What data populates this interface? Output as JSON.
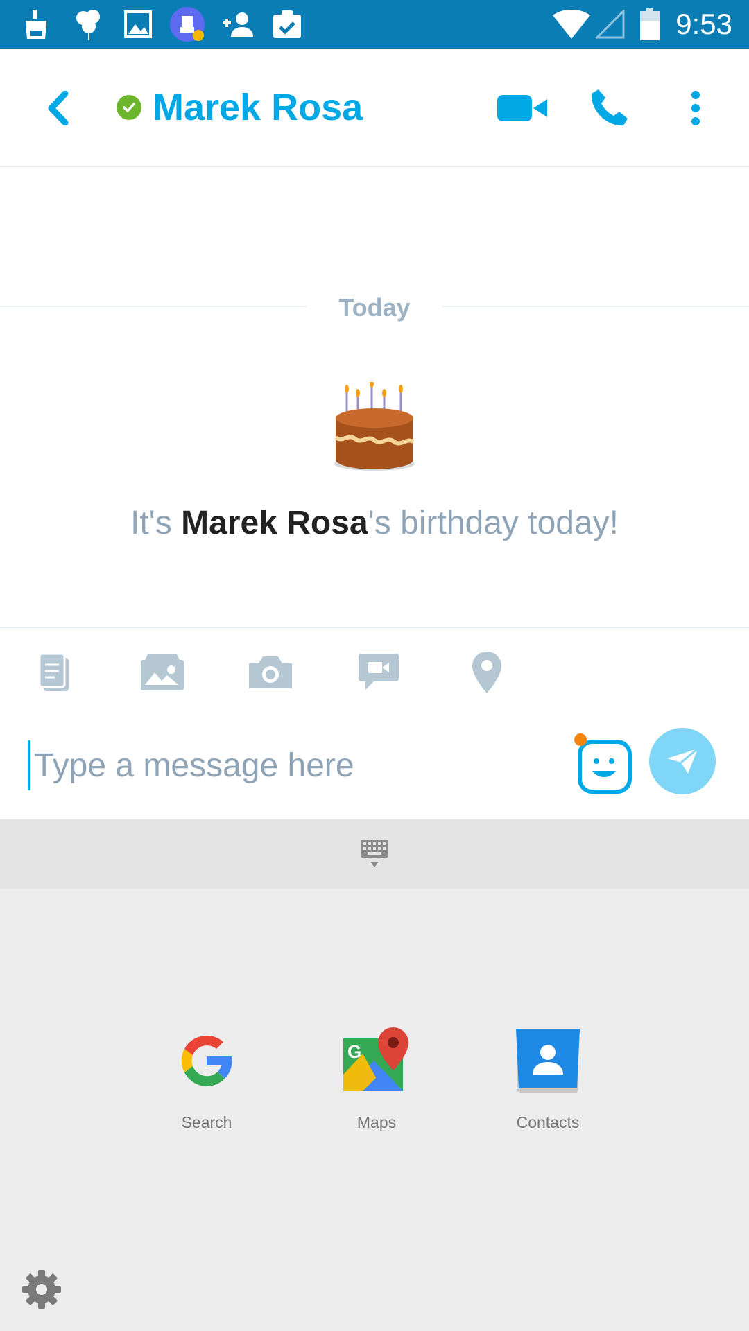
{
  "status_bar": {
    "time": "9:53",
    "icons": [
      "broom-icon",
      "balloons-icon",
      "gallery-icon",
      "cleaner-app-icon",
      "add-contact-icon",
      "clipboard-check-icon",
      "wifi-icon",
      "signal-icon",
      "battery-icon"
    ]
  },
  "header": {
    "contact_name": "Marek Rosa",
    "presence": "online",
    "actions": [
      "back-icon",
      "video-call-icon",
      "phone-call-icon",
      "more-options-icon"
    ]
  },
  "chat": {
    "day_separator": "Today",
    "birthday": {
      "prefix": "It's ",
      "name": "Marek Rosa",
      "suffix": "'s birthday today!"
    }
  },
  "attachments": [
    "file-icon",
    "photo-gallery-icon",
    "camera-icon",
    "video-message-icon",
    "location-icon"
  ],
  "composer": {
    "placeholder": "Type a message here",
    "value": ""
  },
  "app_shortcuts": [
    {
      "label": "Search",
      "icon": "google-icon"
    },
    {
      "label": "Maps",
      "icon": "maps-icon"
    },
    {
      "label": "Contacts",
      "icon": "contacts-icon"
    }
  ],
  "colors": {
    "status_bar": "#0a7db5",
    "accent": "#00a9e6",
    "online": "#6cb52d",
    "send_button": "#7fd6f6",
    "panel_bg": "#ececec"
  }
}
